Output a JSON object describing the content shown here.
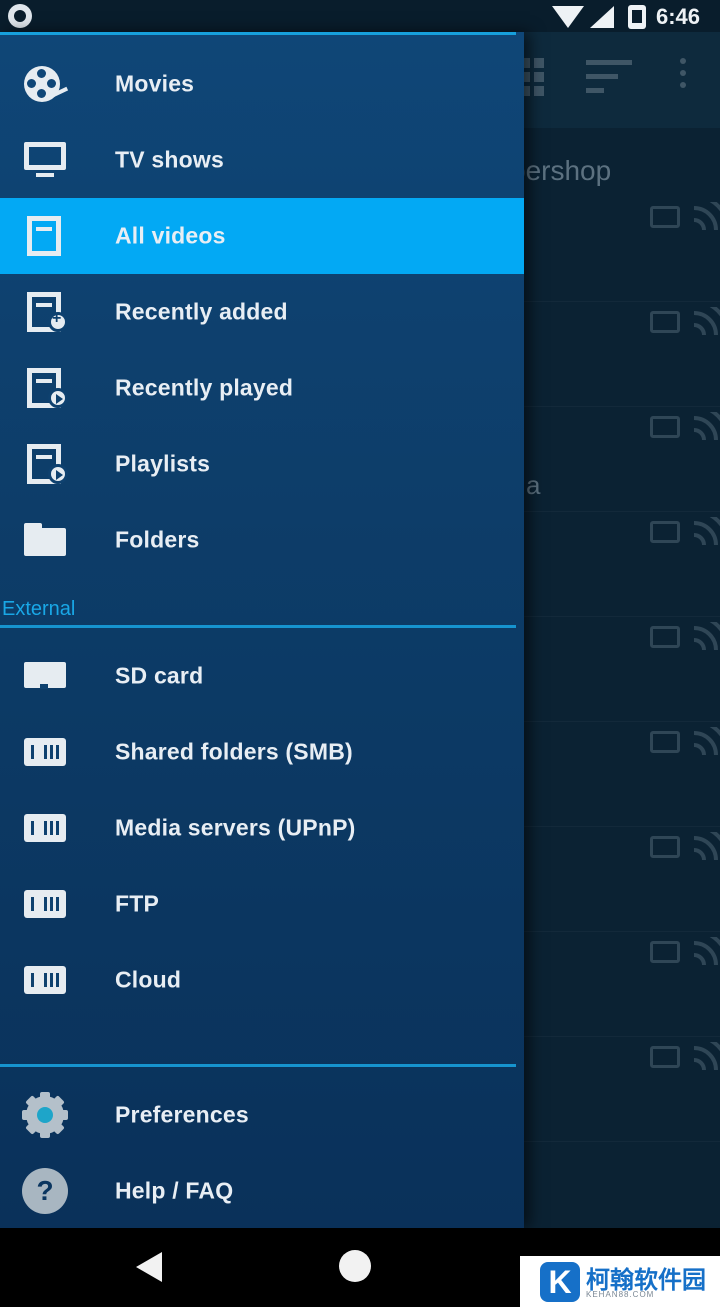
{
  "status_bar": {
    "time": "6:46"
  },
  "background": {
    "title_fragment": "bershop",
    "letter_fragment": "a"
  },
  "drawer": {
    "library_items": [
      {
        "label": "Movies",
        "icon": "movie-reel-icon",
        "active": false
      },
      {
        "label": "TV shows",
        "icon": "tv-icon",
        "active": false
      },
      {
        "label": "All videos",
        "icon": "film-strip-icon",
        "active": true
      },
      {
        "label": "Recently added",
        "icon": "film-add-icon",
        "active": false
      },
      {
        "label": "Recently played",
        "icon": "film-play-icon",
        "active": false
      },
      {
        "label": "Playlists",
        "icon": "playlist-icon",
        "active": false
      },
      {
        "label": "Folders",
        "icon": "folder-icon",
        "active": false
      }
    ],
    "external_section_label": "External",
    "external_items": [
      {
        "label": "SD card",
        "icon": "sd-card-icon"
      },
      {
        "label": "Shared folders (SMB)",
        "icon": "network-drive-icon"
      },
      {
        "label": "Media servers (UPnP)",
        "icon": "network-drive-icon"
      },
      {
        "label": "FTP",
        "icon": "network-drive-icon"
      },
      {
        "label": "Cloud",
        "icon": "network-drive-icon"
      }
    ],
    "footer_items": [
      {
        "label": "Preferences",
        "icon": "gear-icon"
      },
      {
        "label": "Help / FAQ",
        "icon": "help-icon"
      }
    ]
  },
  "watermark": {
    "logo": "K",
    "text": "柯翰软件园",
    "sub": "KEHAN88.COM"
  },
  "colors": {
    "active": "#03a9f4",
    "accent": "#19a7e6",
    "drawer": "#0d3d69"
  }
}
